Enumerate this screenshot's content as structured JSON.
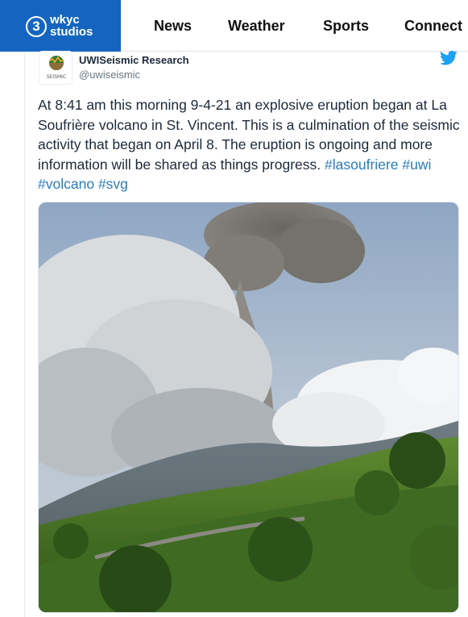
{
  "header": {
    "logo_number": "3",
    "logo_line1": "wkyc",
    "logo_line2": "studios",
    "nav": [
      "News",
      "Weather",
      "Sports",
      "Connect"
    ],
    "brand_color": "#1565c0"
  },
  "tweet": {
    "avatar_label": "SEISMIC",
    "author_name": "UWISeismic Research",
    "author_handle": "@uwiseismic",
    "platform_icon": "twitter-bird-icon",
    "text": "At 8:41 am this morning 9-4-21 an explosive eruption began at La Soufrière volcano in St. Vincent. This is a culmination of the seismic activity that began on April 8. The eruption is ongoing and more information will be shared as things progress.",
    "hashtags": [
      "#lasoufriere",
      "#uwi",
      "#volcano",
      "#svg"
    ],
    "link_color": "#2b7bb9",
    "photo_subject": "volcano-eruption-photo"
  }
}
